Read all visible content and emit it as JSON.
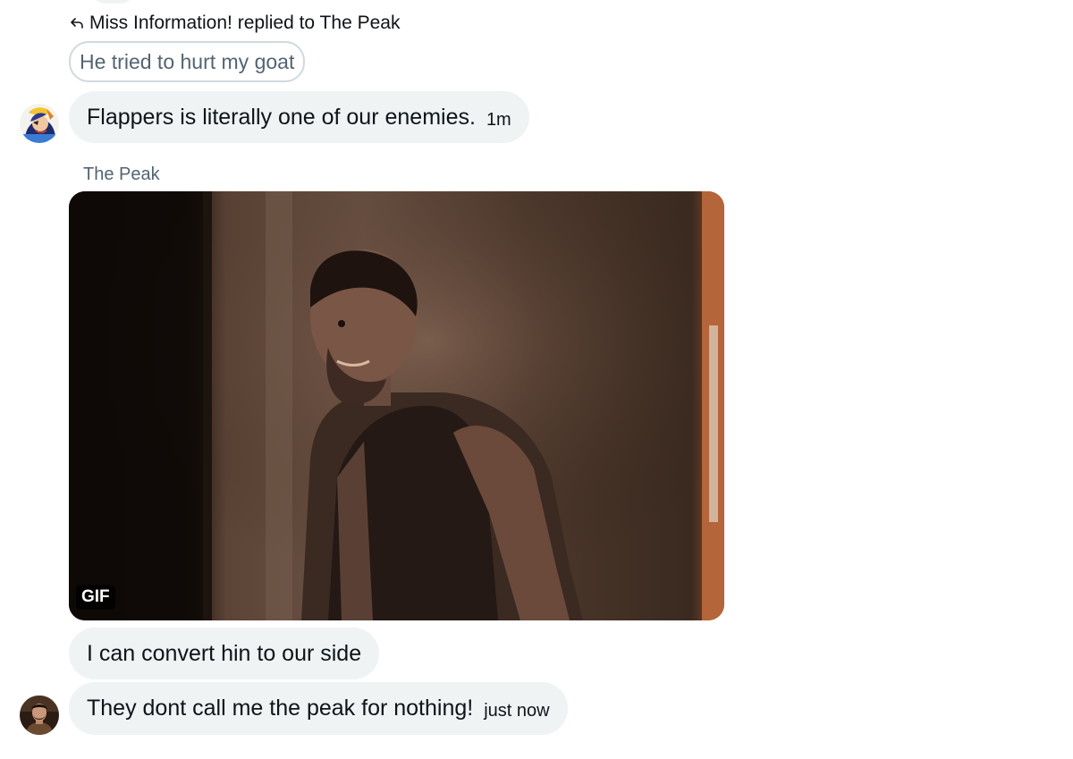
{
  "reply": {
    "context_text": "Miss Information! replied to The Peak",
    "quoted_message": "He tried to hurt my goat"
  },
  "messages": [
    {
      "text": "Flappers is literally one of our enemies.",
      "time": "1m"
    },
    {
      "sender": "The Peak",
      "media_badge": "GIF"
    },
    {
      "text": "I can convert hin to our side"
    },
    {
      "text": "They dont call me the peak for nothing!",
      "time": "just now"
    }
  ],
  "icons": [
    "reply-arrow-icon"
  ],
  "colors": {
    "bubble": "#eff3f4",
    "secondary_text": "#536471",
    "quote_border": "#cfd9de"
  }
}
